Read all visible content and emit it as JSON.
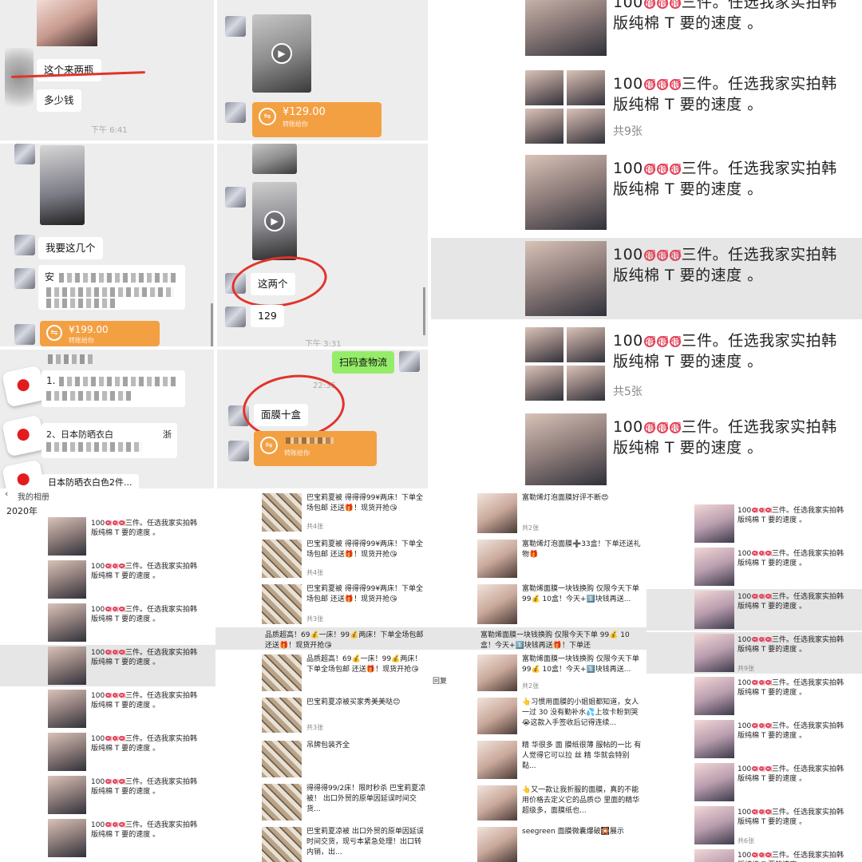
{
  "chat_top_left": {
    "msg1": "这个来两瓶",
    "msg2": "多少钱",
    "time": "下午 6:41"
  },
  "chat_top_mid": {
    "pay_amount": "¥129.00",
    "pay_sub": "转账给你"
  },
  "chat_mid_left": {
    "msg1": "我要这几个",
    "msg2_prefix": "安",
    "pay_amount": "¥199.00",
    "pay_sub": "转账给你"
  },
  "chat_mid_mid": {
    "msg1": "这两个",
    "msg2": "129",
    "time": "下午 3:31"
  },
  "chat_bot_left": {
    "msg1_prefix": "1.",
    "msg2": "2、日本防晒衣白",
    "msg2_tail": "浙",
    "msg3": "日本防晒衣白色2件..."
  },
  "chat_bot_mid": {
    "scan": "扫码查物流",
    "time": "22:35",
    "msg1": "面膜十盒",
    "pay_sub": "转账给你"
  },
  "moments_big": {
    "text_line1_pre": "100",
    "de": "得",
    "text_line1_post": "三件。任选我家实拍韩",
    "text_line2": "版纯棉 T 要的速度 。",
    "count_9": "共9张",
    "count_5": "共5张"
  },
  "moments_col1": {
    "header": "我的相册",
    "year": "2020年",
    "line1_pre": "100",
    "line1_post": "三件。任选我家实拍韩",
    "line2": "版纯棉 T 要的速度 。"
  },
  "moments_col2": {
    "p1": "巴宝莉夏被 得得得99¥两床！下单全场包邮 还送🎁！现货开抢😘",
    "c1": "共4张",
    "c2": "共4张",
    "c3": "共3张",
    "p4": "品质超高！69💰一床！99💰两床！下单全场包邮 还送🎁！现货开抢😘",
    "p6": "巴宝莉夏凉被买家秀美美哒😊",
    "c6": "共3张",
    "p7": "吊牌包装齐全",
    "p8": "得得得99/2床！限时秒杀 巴宝莉夏凉被！\n出口外贸的原单因延误时间交货...",
    "p9": "巴宝莉夏凉被\n出口外贸的原单因延误时间交货，现亏本紧急处理！出口转内销，出..."
  },
  "moments_col3": {
    "p1": "富勒烯灯泡面膜好评不断😍",
    "c1": "共2张",
    "p2": "富勒烯灯泡面膜➕33盒！下单还送礼物🎁",
    "p3": "富勒烯面膜一块钱换购 仅限今天下单\n99💰 10盒！今天+1️⃣块钱再送...",
    "p4": "富勒烯面膜一块钱换购 仅限今天下单\n99💰 10盒！今天+1️⃣块钱再送🎁！下单还",
    "c5": "共2张",
    "p6": "👆习惯用面膜的小姐姐都知道，女人一过 30 没有勤补水💦上妆卡粉到哭😭这款入手签收后记得连续...",
    "p7": "精 华很多 面 膜纸很薄 服帖的一比 有人觉得它可以拉 丝 精 华就会特别黏...",
    "p8": "👆又一款让我折服的面膜，真的不能用价格去定义它的品质😊\n里面的精华超级多，面膜纸也...",
    "p9": "seegreen 面膜微囊爆破🎇展示",
    "reply": "回复"
  },
  "moments_col4": {
    "line1_pre": "100",
    "line1_post": "三件。任选我家实拍韩",
    "line2": "版纯棉 T 要的速度 。",
    "c9": "共9张",
    "c6": "共6张"
  }
}
